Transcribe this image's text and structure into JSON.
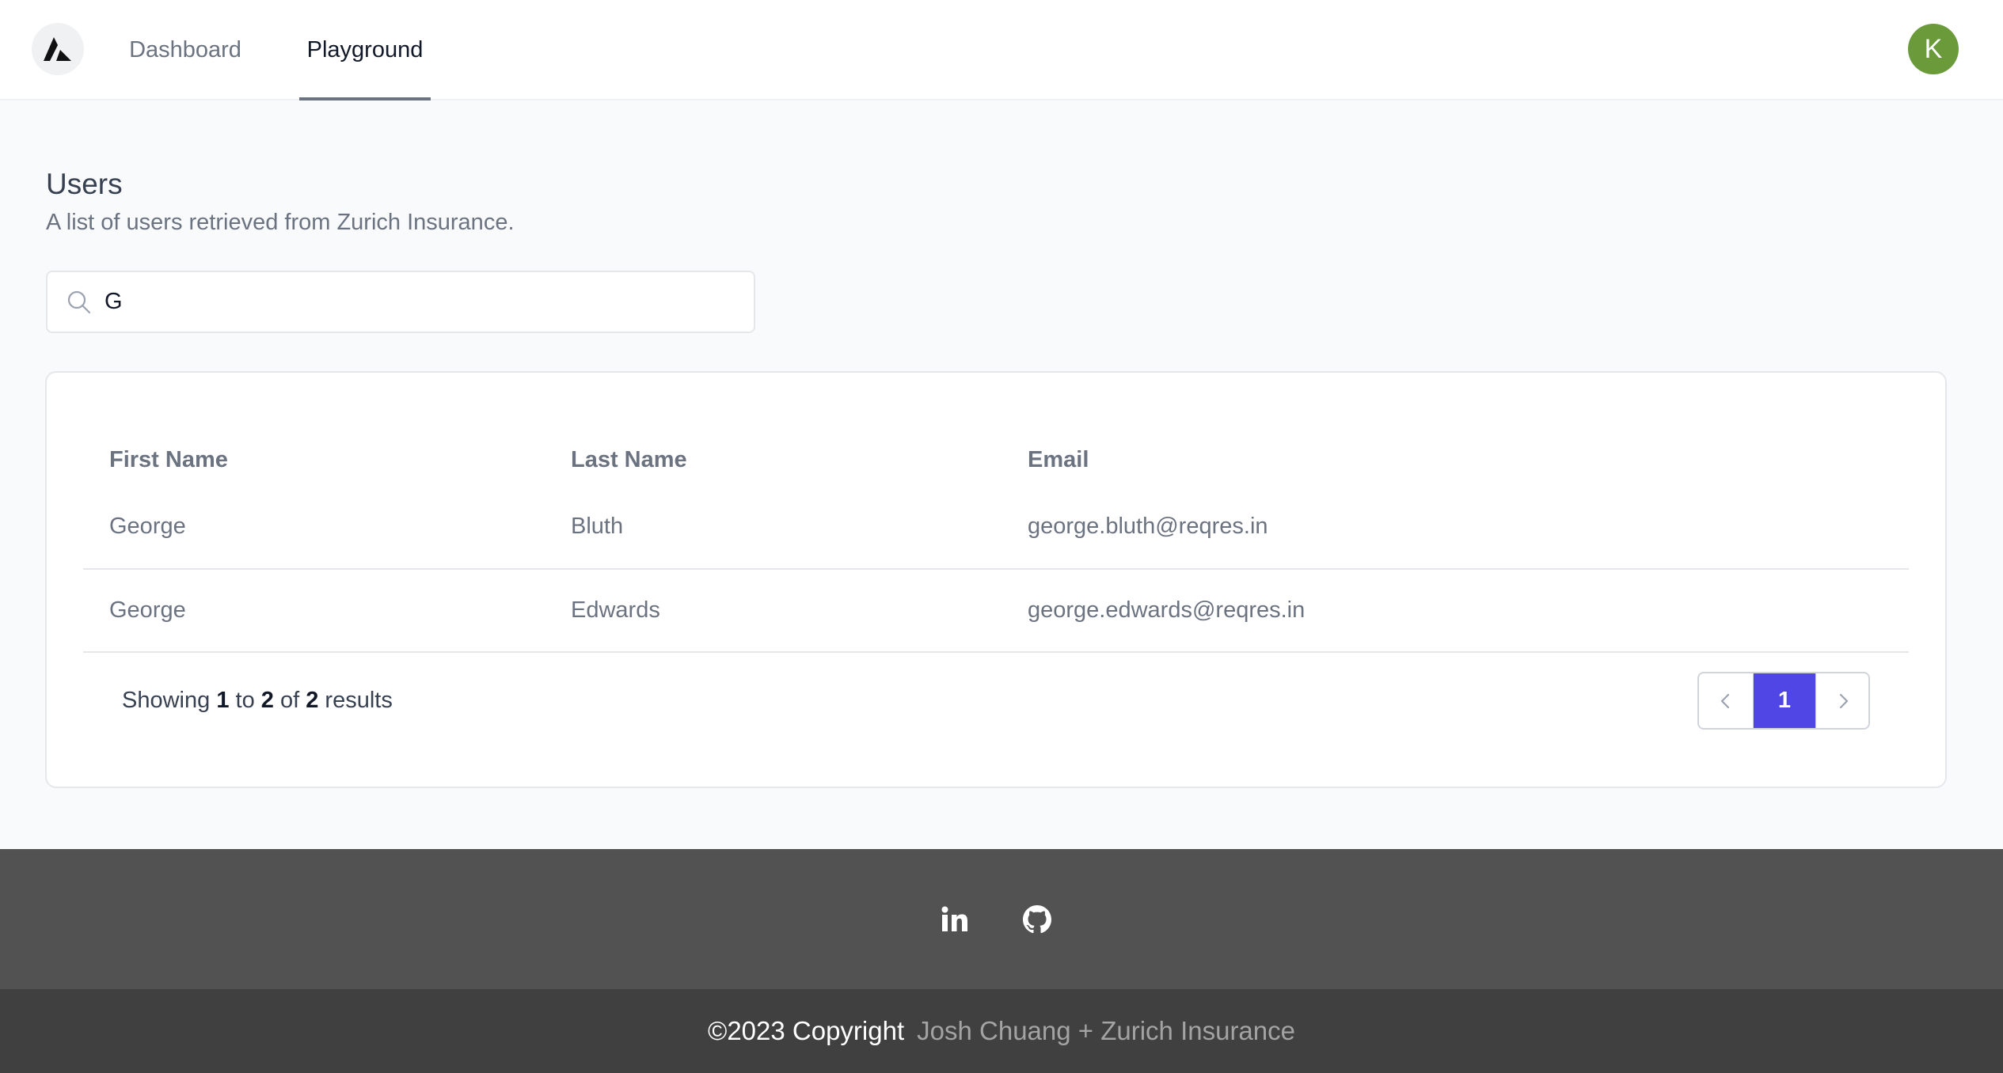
{
  "header": {
    "logo_icon": "triangle-logo-icon",
    "tabs": [
      {
        "label": "Dashboard",
        "active": false
      },
      {
        "label": "Playground",
        "active": true
      }
    ],
    "avatar_initial": "K",
    "avatar_color": "#6b9a3b"
  },
  "main": {
    "title": "Users",
    "subtitle": "A list of users retrieved from Zurich Insurance.",
    "search": {
      "value": "G",
      "icon": "search-icon"
    },
    "table": {
      "columns": [
        "First Name",
        "Last Name",
        "Email"
      ],
      "rows": [
        [
          "George",
          "Bluth",
          "george.bluth@reqres.in"
        ],
        [
          "George",
          "Edwards",
          "george.edwards@reqres.in"
        ]
      ]
    },
    "results": {
      "prefix": "Showing",
      "from": "1",
      "to_word": "to",
      "to": "2",
      "of_word": "of",
      "total": "2",
      "suffix": "results"
    },
    "pagination": {
      "current_page": "1",
      "accent": "#4f46e5"
    }
  },
  "footer": {
    "social_icons": [
      "linkedin-icon",
      "github-icon"
    ],
    "copyright": "©2023 Copyright",
    "author": "Josh Chuang + Zurich Insurance"
  }
}
